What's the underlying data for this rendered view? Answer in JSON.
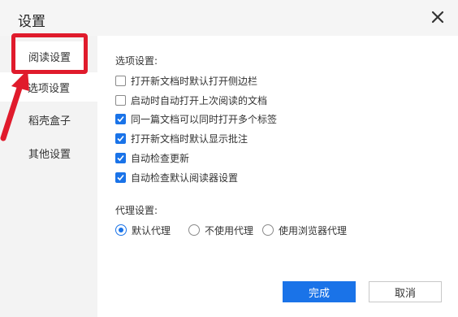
{
  "window": {
    "title": "设置",
    "close_icon": "close-icon"
  },
  "sidebar": {
    "items": [
      {
        "label": "阅读设置"
      },
      {
        "label": "选项设置"
      },
      {
        "label": "稻壳盒子"
      },
      {
        "label": "其他设置"
      }
    ],
    "active_index": 1,
    "highlighted_index": 0
  },
  "options": {
    "section_label": "选项设置:",
    "checkboxes": [
      {
        "label": "打开新文档时默认打开侧边栏",
        "checked": false
      },
      {
        "label": "启动时自动打开上次阅读的文档",
        "checked": false
      },
      {
        "label": "同一篇文档可以同时打开多个标签",
        "checked": true
      },
      {
        "label": "打开新文档时默认显示批注",
        "checked": true
      },
      {
        "label": "自动检查更新",
        "checked": true
      },
      {
        "label": "自动检查默认阅读器设置",
        "checked": true
      }
    ]
  },
  "proxy": {
    "section_label": "代理设置:",
    "options": [
      {
        "label": "默认代理",
        "selected": true
      },
      {
        "label": "不使用代理",
        "selected": false
      },
      {
        "label": "使用浏览器代理",
        "selected": false
      }
    ]
  },
  "footer": {
    "ok_label": "完成",
    "cancel_label": "取消"
  },
  "colors": {
    "accent": "#1a73e8",
    "annotation": "#e01b2c"
  }
}
